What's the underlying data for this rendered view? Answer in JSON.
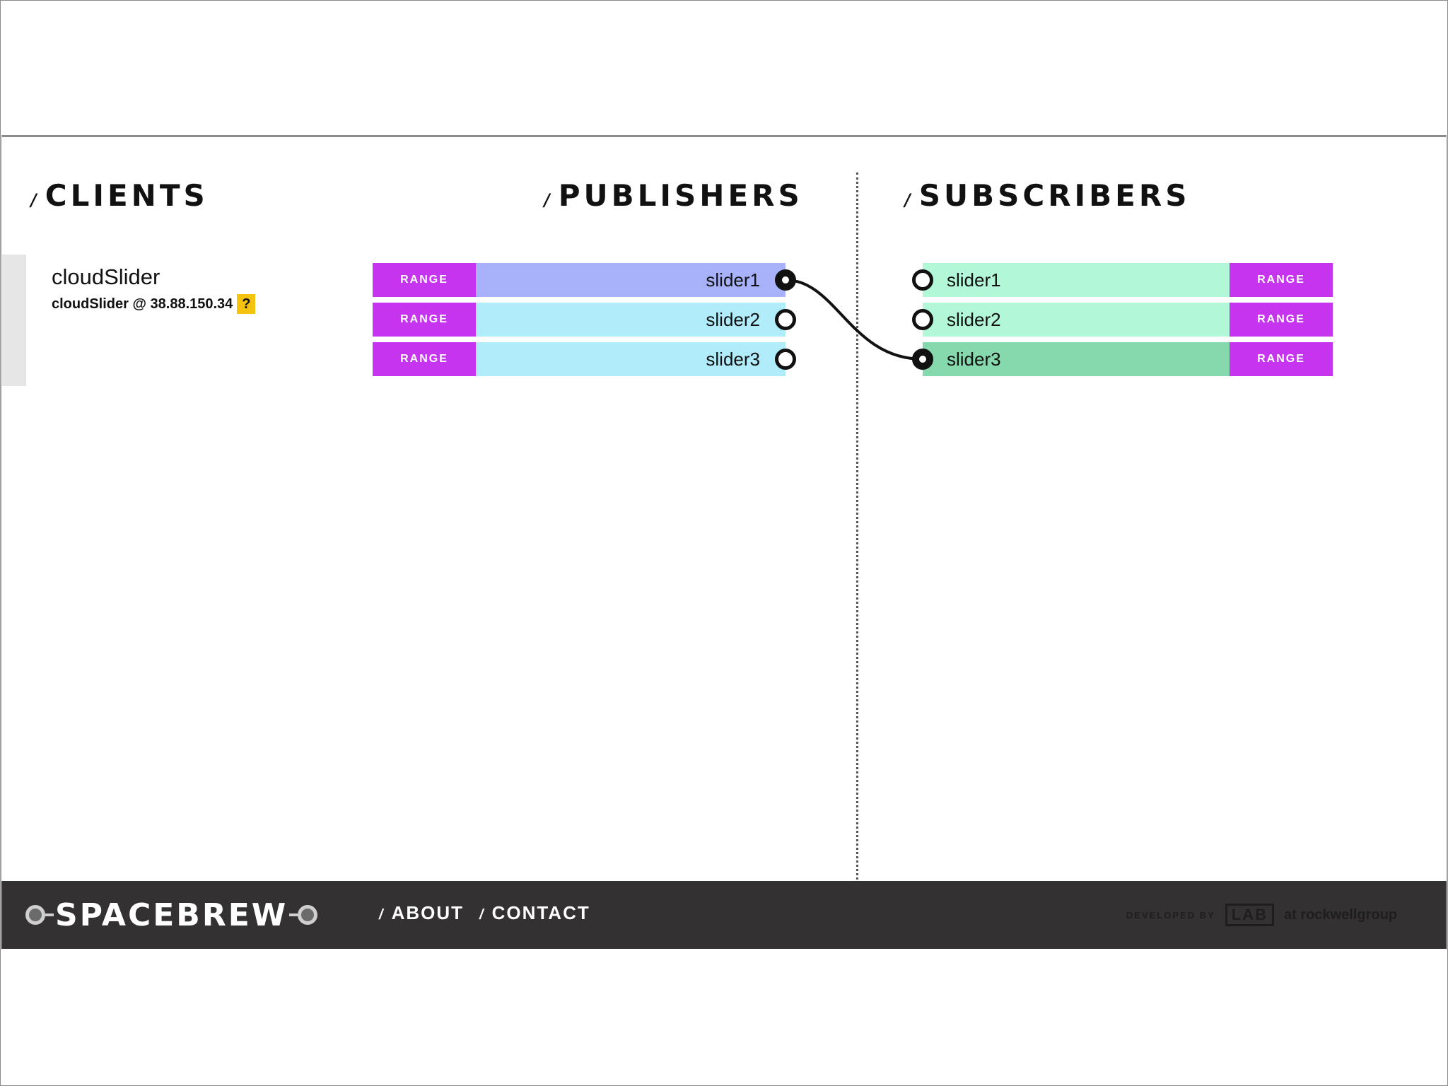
{
  "sections": {
    "clients": "CLIENTS",
    "publishers": "PUBLISHERS",
    "subscribers": "SUBSCRIBERS",
    "slash": "/"
  },
  "client": {
    "name": "cloudSlider",
    "address": "cloudSlider @ 38.88.150.34",
    "help": "?"
  },
  "publishers": [
    {
      "type": "RANGE",
      "name": "slider1",
      "connected": true
    },
    {
      "type": "RANGE",
      "name": "slider2",
      "connected": false
    },
    {
      "type": "RANGE",
      "name": "slider3",
      "connected": false
    }
  ],
  "subscribers": [
    {
      "type": "RANGE",
      "name": "slider1",
      "connected": false
    },
    {
      "type": "RANGE",
      "name": "slider2",
      "connected": false
    },
    {
      "type": "RANGE",
      "name": "slider3",
      "connected": true
    }
  ],
  "route": {
    "from": "slider1",
    "to": "slider3"
  },
  "colors": {
    "range": "#c634f0",
    "publisher_active": "#a8b2fb",
    "publisher": "#b1ecfb",
    "subscriber": "#b3f7d9",
    "subscriber_active": "#86d8ad",
    "help_badge": "#f3c30f",
    "footer": "#333132"
  },
  "footer": {
    "logo": "SPACEBREW",
    "about": "ABOUT",
    "contact": "CONTACT",
    "slash": "/",
    "credit_prefix": "DEVELOPED BY",
    "credit_lab": "LAB",
    "credit_suffix": "at rockwellgroup"
  }
}
